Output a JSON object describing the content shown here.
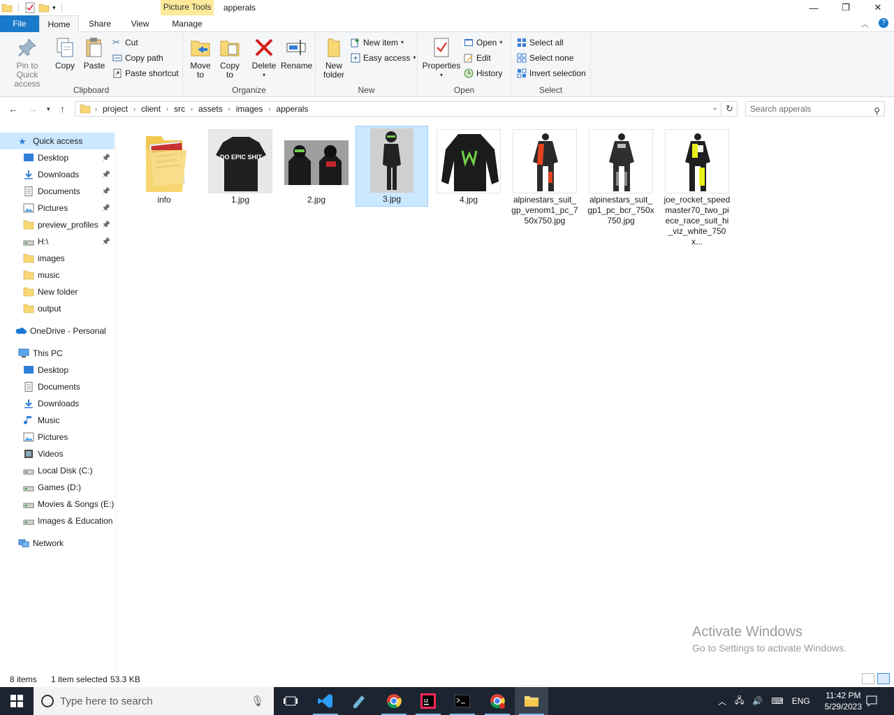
{
  "window": {
    "title": "apperals",
    "context_tab": "Picture Tools",
    "controls": [
      "—",
      "❐",
      "✕"
    ]
  },
  "ribbon_tabs": [
    "File",
    "Home",
    "Share",
    "View",
    "Manage"
  ],
  "ribbon": {
    "clipboard": {
      "label": "Clipboard",
      "pin": "Pin to Quick access",
      "copy": "Copy",
      "paste": "Paste",
      "cut": "Cut",
      "copy_path": "Copy path",
      "paste_shortcut": "Paste shortcut"
    },
    "organize": {
      "label": "Organize",
      "move_to": "Move to",
      "copy_to": "Copy to",
      "delete": "Delete",
      "rename": "Rename"
    },
    "new": {
      "label": "New",
      "new_folder": "New folder",
      "new_item": "New item",
      "easy_access": "Easy access"
    },
    "open": {
      "label": "Open",
      "properties": "Properties",
      "open": "Open",
      "edit": "Edit",
      "history": "History"
    },
    "select": {
      "label": "Select",
      "select_all": "Select all",
      "select_none": "Select none",
      "invert": "Invert selection"
    }
  },
  "address": {
    "crumbs": [
      "project",
      "client",
      "src",
      "assets",
      "images",
      "apperals"
    ],
    "search_placeholder": "Search apperals"
  },
  "navpane": {
    "quick_access": "Quick access",
    "quick_items": [
      {
        "label": "Desktop",
        "icon": "desktop-icon",
        "pinned": true
      },
      {
        "label": "Downloads",
        "icon": "download-icon",
        "pinned": true
      },
      {
        "label": "Documents",
        "icon": "document-icon",
        "pinned": true
      },
      {
        "label": "Pictures",
        "icon": "pictures-icon",
        "pinned": true
      },
      {
        "label": "preview_profiles",
        "icon": "folder-icon",
        "pinned": true
      },
      {
        "label": "H:\\",
        "icon": "drive-icon",
        "pinned": true
      },
      {
        "label": "images",
        "icon": "folder-icon",
        "pinned": false
      },
      {
        "label": "music",
        "icon": "folder-icon",
        "pinned": false
      },
      {
        "label": "New folder",
        "icon": "folder-icon",
        "pinned": false
      },
      {
        "label": "output",
        "icon": "folder-icon",
        "pinned": false
      }
    ],
    "onedrive": "OneDrive - Personal",
    "this_pc": "This PC",
    "pc_items": [
      {
        "label": "Desktop",
        "icon": "desktop-icon"
      },
      {
        "label": "Documents",
        "icon": "document-icon"
      },
      {
        "label": "Downloads",
        "icon": "download-icon"
      },
      {
        "label": "Music",
        "icon": "music-icon"
      },
      {
        "label": "Pictures",
        "icon": "pictures-icon"
      },
      {
        "label": "Videos",
        "icon": "video-icon"
      },
      {
        "label": "Local Disk (C:)",
        "icon": "drive-icon"
      },
      {
        "label": "Games (D:)",
        "icon": "drive-icon"
      },
      {
        "label": "Movies & Songs (E:)",
        "icon": "drive-icon"
      },
      {
        "label": "Images & Education",
        "icon": "drive-icon"
      }
    ],
    "network": "Network"
  },
  "files": [
    {
      "name": "info",
      "kind": "folder"
    },
    {
      "name": "1.jpg",
      "kind": "image"
    },
    {
      "name": "2.jpg",
      "kind": "image"
    },
    {
      "name": "3.jpg",
      "kind": "image",
      "selected": true
    },
    {
      "name": "4.jpg",
      "kind": "image"
    },
    {
      "name": "alpinestars_suit_gp_venom1_pc_750x750.jpg",
      "kind": "image"
    },
    {
      "name": "alpinestars_suit_gp1_pc_bcr_750x750.jpg",
      "kind": "image"
    },
    {
      "name": "joe_rocket_speedmaster70_two_piece_race_suit_hi_viz_white_750x...",
      "kind": "image"
    }
  ],
  "thumb_text": {
    "shirt": "DO EPIC SHIT"
  },
  "watermark": {
    "line1": "Activate Windows",
    "line2": "Go to Settings to activate Windows."
  },
  "status": {
    "items": "8 items",
    "selected": "1 item selected",
    "size": "53.3 KB"
  },
  "taskbar": {
    "search_placeholder": "Type here to search",
    "lang": "ENG",
    "time": "11:42 PM",
    "date": "5/29/2023"
  },
  "colors": {
    "accent": "#1979ca",
    "selection": "#cce8ff",
    "folder": "#f8d775",
    "taskbar": "#1c2431"
  }
}
